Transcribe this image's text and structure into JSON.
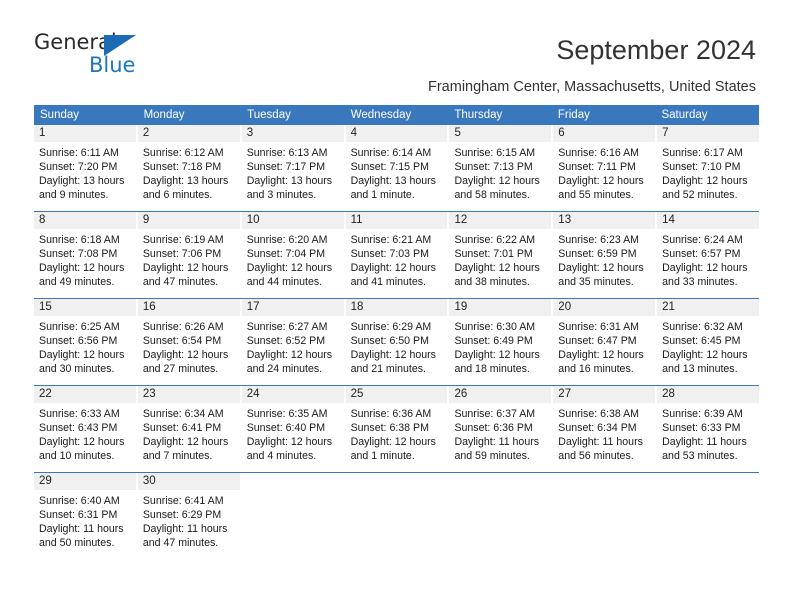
{
  "logo": {
    "primary_text": "General",
    "secondary_text": "Blue",
    "primary_color": "#2b2b2b",
    "secondary_color": "#1b76c4",
    "triangle_color": "#1b6cb5"
  },
  "header": {
    "title": "September 2024",
    "subtitle": "Framingham Center, Massachusetts, United States"
  },
  "theme": {
    "header_bg": "#3a78bd",
    "header_text": "#ffffff",
    "daynum_bg": "#f0f0f0",
    "row_border": "#3a78bd"
  },
  "weekdays": [
    "Sunday",
    "Monday",
    "Tuesday",
    "Wednesday",
    "Thursday",
    "Friday",
    "Saturday"
  ],
  "weeks": [
    [
      {
        "day": "1",
        "sunrise": "Sunrise: 6:11 AM",
        "sunset": "Sunset: 7:20 PM",
        "daylight1": "Daylight: 13 hours",
        "daylight2": "and 9 minutes."
      },
      {
        "day": "2",
        "sunrise": "Sunrise: 6:12 AM",
        "sunset": "Sunset: 7:18 PM",
        "daylight1": "Daylight: 13 hours",
        "daylight2": "and 6 minutes."
      },
      {
        "day": "3",
        "sunrise": "Sunrise: 6:13 AM",
        "sunset": "Sunset: 7:17 PM",
        "daylight1": "Daylight: 13 hours",
        "daylight2": "and 3 minutes."
      },
      {
        "day": "4",
        "sunrise": "Sunrise: 6:14 AM",
        "sunset": "Sunset: 7:15 PM",
        "daylight1": "Daylight: 13 hours",
        "daylight2": "and 1 minute."
      },
      {
        "day": "5",
        "sunrise": "Sunrise: 6:15 AM",
        "sunset": "Sunset: 7:13 PM",
        "daylight1": "Daylight: 12 hours",
        "daylight2": "and 58 minutes."
      },
      {
        "day": "6",
        "sunrise": "Sunrise: 6:16 AM",
        "sunset": "Sunset: 7:11 PM",
        "daylight1": "Daylight: 12 hours",
        "daylight2": "and 55 minutes."
      },
      {
        "day": "7",
        "sunrise": "Sunrise: 6:17 AM",
        "sunset": "Sunset: 7:10 PM",
        "daylight1": "Daylight: 12 hours",
        "daylight2": "and 52 minutes."
      }
    ],
    [
      {
        "day": "8",
        "sunrise": "Sunrise: 6:18 AM",
        "sunset": "Sunset: 7:08 PM",
        "daylight1": "Daylight: 12 hours",
        "daylight2": "and 49 minutes."
      },
      {
        "day": "9",
        "sunrise": "Sunrise: 6:19 AM",
        "sunset": "Sunset: 7:06 PM",
        "daylight1": "Daylight: 12 hours",
        "daylight2": "and 47 minutes."
      },
      {
        "day": "10",
        "sunrise": "Sunrise: 6:20 AM",
        "sunset": "Sunset: 7:04 PM",
        "daylight1": "Daylight: 12 hours",
        "daylight2": "and 44 minutes."
      },
      {
        "day": "11",
        "sunrise": "Sunrise: 6:21 AM",
        "sunset": "Sunset: 7:03 PM",
        "daylight1": "Daylight: 12 hours",
        "daylight2": "and 41 minutes."
      },
      {
        "day": "12",
        "sunrise": "Sunrise: 6:22 AM",
        "sunset": "Sunset: 7:01 PM",
        "daylight1": "Daylight: 12 hours",
        "daylight2": "and 38 minutes."
      },
      {
        "day": "13",
        "sunrise": "Sunrise: 6:23 AM",
        "sunset": "Sunset: 6:59 PM",
        "daylight1": "Daylight: 12 hours",
        "daylight2": "and 35 minutes."
      },
      {
        "day": "14",
        "sunrise": "Sunrise: 6:24 AM",
        "sunset": "Sunset: 6:57 PM",
        "daylight1": "Daylight: 12 hours",
        "daylight2": "and 33 minutes."
      }
    ],
    [
      {
        "day": "15",
        "sunrise": "Sunrise: 6:25 AM",
        "sunset": "Sunset: 6:56 PM",
        "daylight1": "Daylight: 12 hours",
        "daylight2": "and 30 minutes."
      },
      {
        "day": "16",
        "sunrise": "Sunrise: 6:26 AM",
        "sunset": "Sunset: 6:54 PM",
        "daylight1": "Daylight: 12 hours",
        "daylight2": "and 27 minutes."
      },
      {
        "day": "17",
        "sunrise": "Sunrise: 6:27 AM",
        "sunset": "Sunset: 6:52 PM",
        "daylight1": "Daylight: 12 hours",
        "daylight2": "and 24 minutes."
      },
      {
        "day": "18",
        "sunrise": "Sunrise: 6:29 AM",
        "sunset": "Sunset: 6:50 PM",
        "daylight1": "Daylight: 12 hours",
        "daylight2": "and 21 minutes."
      },
      {
        "day": "19",
        "sunrise": "Sunrise: 6:30 AM",
        "sunset": "Sunset: 6:49 PM",
        "daylight1": "Daylight: 12 hours",
        "daylight2": "and 18 minutes."
      },
      {
        "day": "20",
        "sunrise": "Sunrise: 6:31 AM",
        "sunset": "Sunset: 6:47 PM",
        "daylight1": "Daylight: 12 hours",
        "daylight2": "and 16 minutes."
      },
      {
        "day": "21",
        "sunrise": "Sunrise: 6:32 AM",
        "sunset": "Sunset: 6:45 PM",
        "daylight1": "Daylight: 12 hours",
        "daylight2": "and 13 minutes."
      }
    ],
    [
      {
        "day": "22",
        "sunrise": "Sunrise: 6:33 AM",
        "sunset": "Sunset: 6:43 PM",
        "daylight1": "Daylight: 12 hours",
        "daylight2": "and 10 minutes."
      },
      {
        "day": "23",
        "sunrise": "Sunrise: 6:34 AM",
        "sunset": "Sunset: 6:41 PM",
        "daylight1": "Daylight: 12 hours",
        "daylight2": "and 7 minutes."
      },
      {
        "day": "24",
        "sunrise": "Sunrise: 6:35 AM",
        "sunset": "Sunset: 6:40 PM",
        "daylight1": "Daylight: 12 hours",
        "daylight2": "and 4 minutes."
      },
      {
        "day": "25",
        "sunrise": "Sunrise: 6:36 AM",
        "sunset": "Sunset: 6:38 PM",
        "daylight1": "Daylight: 12 hours",
        "daylight2": "and 1 minute."
      },
      {
        "day": "26",
        "sunrise": "Sunrise: 6:37 AM",
        "sunset": "Sunset: 6:36 PM",
        "daylight1": "Daylight: 11 hours",
        "daylight2": "and 59 minutes."
      },
      {
        "day": "27",
        "sunrise": "Sunrise: 6:38 AM",
        "sunset": "Sunset: 6:34 PM",
        "daylight1": "Daylight: 11 hours",
        "daylight2": "and 56 minutes."
      },
      {
        "day": "28",
        "sunrise": "Sunrise: 6:39 AM",
        "sunset": "Sunset: 6:33 PM",
        "daylight1": "Daylight: 11 hours",
        "daylight2": "and 53 minutes."
      }
    ],
    [
      {
        "day": "29",
        "sunrise": "Sunrise: 6:40 AM",
        "sunset": "Sunset: 6:31 PM",
        "daylight1": "Daylight: 11 hours",
        "daylight2": "and 50 minutes."
      },
      {
        "day": "30",
        "sunrise": "Sunrise: 6:41 AM",
        "sunset": "Sunset: 6:29 PM",
        "daylight1": "Daylight: 11 hours",
        "daylight2": "and 47 minutes."
      },
      {
        "day": "",
        "sunrise": "",
        "sunset": "",
        "daylight1": "",
        "daylight2": ""
      },
      {
        "day": "",
        "sunrise": "",
        "sunset": "",
        "daylight1": "",
        "daylight2": ""
      },
      {
        "day": "",
        "sunrise": "",
        "sunset": "",
        "daylight1": "",
        "daylight2": ""
      },
      {
        "day": "",
        "sunrise": "",
        "sunset": "",
        "daylight1": "",
        "daylight2": ""
      },
      {
        "day": "",
        "sunrise": "",
        "sunset": "",
        "daylight1": "",
        "daylight2": ""
      }
    ]
  ]
}
